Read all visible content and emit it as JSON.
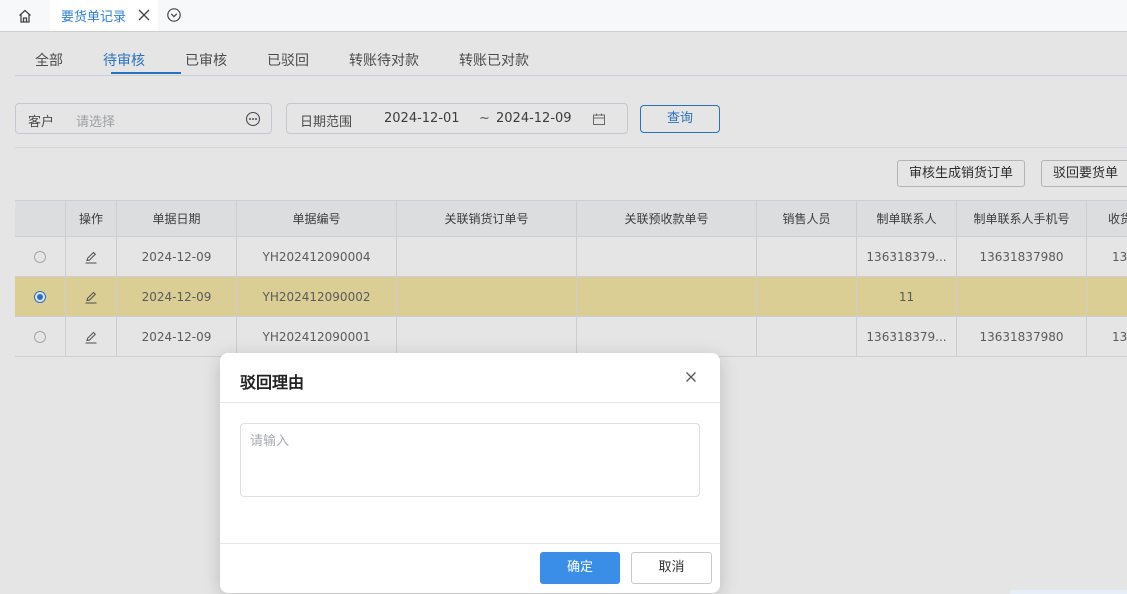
{
  "page_tabs": {
    "active_tab_label": "要货单记录"
  },
  "status_tabs": [
    {
      "label": "全部"
    },
    {
      "label": "待审核"
    },
    {
      "label": "已审核"
    },
    {
      "label": "已驳回"
    },
    {
      "label": "转账待对款"
    },
    {
      "label": "转账已对款"
    }
  ],
  "filters": {
    "customer_label": "客户",
    "customer_placeholder": "请选择",
    "date_label": "日期范围",
    "date_start": "2024-12-01",
    "date_tilde": "~",
    "date_end": "2024-12-09",
    "query_label": "查询"
  },
  "actions": {
    "approve_label": "审核生成销货订单",
    "reject_label": "驳回要货单"
  },
  "table": {
    "headers": [
      "操作",
      "单据日期",
      "单据编号",
      "关联销货订单号",
      "关联预收款单号",
      "销售人员",
      "制单联系人",
      "制单联系人手机号",
      "收货"
    ],
    "rows": [
      {
        "selected": false,
        "date": "2024-12-09",
        "number": "YH202412090004",
        "sales_order": "",
        "prepay": "",
        "salesperson": "",
        "contact": "136318379...",
        "phone": "13631837980",
        "extra": "13"
      },
      {
        "selected": true,
        "date": "2024-12-09",
        "number": "YH202412090002",
        "sales_order": "",
        "prepay": "",
        "salesperson": "",
        "contact": "11",
        "phone": "",
        "extra": ""
      },
      {
        "selected": false,
        "date": "2024-12-09",
        "number": "YH202412090001",
        "sales_order": "",
        "prepay": "",
        "salesperson": "",
        "contact": "136318379...",
        "phone": "13631837980",
        "extra": "13"
      }
    ]
  },
  "dialog": {
    "title": "驳回理由",
    "textarea_placeholder": "请输入",
    "textarea_value": "",
    "confirm_label": "确定",
    "cancel_label": "取消"
  },
  "colors": {
    "accent": "#2f7dd3",
    "primary_button": "#3a8ee6",
    "selected_row": "#f3e6a6"
  },
  "icons": [
    "home-icon",
    "close-icon",
    "chevron-down-circle-icon",
    "more-icon",
    "calendar-icon",
    "edit-icon"
  ]
}
